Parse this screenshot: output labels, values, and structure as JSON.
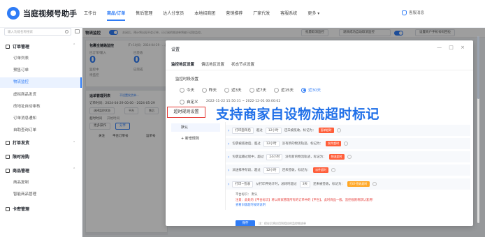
{
  "app": {
    "title": "当庭视频号助手"
  },
  "nav": {
    "items": [
      "工作台",
      "商品/订单",
      "售后管理",
      "达人分享员",
      "本地招商团",
      "营销推荐",
      "厂家代发",
      "客服系统",
      "更多 ▾"
    ],
    "active_index": 1,
    "right_label": "客服消息"
  },
  "sidebar": {
    "search_placeholder": "输入功能名称搜索",
    "groups": [
      {
        "label": "订单管理",
        "items": [
          "订单列表",
          "预售订单",
          "物流监控",
          "虚拟商品发货",
          "改地址自动审核",
          "订单消息通知",
          "自助查询订单"
        ]
      },
      {
        "label": "打单发货"
      },
      {
        "label": "限时抢购"
      },
      {
        "label": "商品管理",
        "items": [
          "商品复制",
          "智能商品管理"
        ]
      },
      {
        "label": "卡密管理"
      }
    ],
    "active_item": "物流监控"
  },
  "monitor": {
    "title": "物流监控",
    "desc": "关闭后，预计将出现不会订单，已订阅的物流单将被只读取监控。",
    "btn_batch": "批量取消监控",
    "btn_auto": "退款成功自动取消监控",
    "btn_phone": "设置商户手机号码回拉"
  },
  "left_card": {
    "title": "包裹全链路监控",
    "sub": "(T+1时间：2024-04-29 - ...)",
    "stat1_label": "已订单/输入",
    "stat1_value": "0",
    "stat1_small": "监控中",
    "stat2_label": "已签收",
    "stat2_value": "0",
    "stat2_small": "已完成",
    "waiting_label": "待监控"
  },
  "list_card": {
    "title": "运单管理列表",
    "link": "不设置发货单...",
    "order_time": "订单时间：2024-04-29 00:00 - 2024-05-29",
    "filter1": "选择监控状态",
    "filter2": "平台",
    "filter3": "售后",
    "timeout_label": "超时时间",
    "timeout_value": "开始时间",
    "btn_more": "更多操作",
    "btn_share": "分享",
    "col1": "关注",
    "col2": "平台订单号",
    "col3": "运单号"
  },
  "dialog": {
    "title": "设置",
    "tabs": [
      "监控地区设置",
      "偏远地区设置",
      "状态节点设置"
    ],
    "active_tab": 0,
    "section_label": "监控时段设置",
    "radios": [
      "今天",
      "昨天",
      "近3天",
      "近7天",
      "近15天",
      "近30天"
    ],
    "radio_selected": 5,
    "custom_label": "自定义",
    "date_from": "2022-11-22 15:50:31",
    "date_sep": "~",
    "date_to": "2022-12-01 00:00:02",
    "highlight_label": "超时规则设置",
    "caption": "支持商家自设物流超时标记",
    "rule_default": "默认",
    "rule_add": "+ 新增规则",
    "rules": [
      {
        "prefix": "打印面单后",
        "mid": "超过",
        "sel": "12小时",
        "text": "还未被揽收，标记为：",
        "tag": "面单超时"
      },
      {
        "prefix": "包裹被揽收后，超过",
        "mid": "",
        "sel": "12小时",
        "text": "没有新的物流轨迹，标记为：",
        "tag": "发件超时"
      },
      {
        "prefix": "包裹运输过程中，超过",
        "mid": "",
        "sel": "24小时",
        "text": "没有新的物流轨迹，标记为：",
        "tag": "物流超时"
      },
      {
        "prefix": "派送排件阶段，超过",
        "mid": "",
        "sel": "12小时",
        "text": "还未签收，标记为：",
        "tag": "派件超时"
      },
      {
        "prefix": "打印~签收",
        "mid": "从打印开始计时，总耗时超过",
        "sel": "3天",
        "text": "还未被签收，标记为：",
        "tag": "打印-签收超时"
      }
    ],
    "note1": "平台标识：   默认",
    "note2": "注意：此处的【平台标识】将以商家管理所有的订单中的【平台】，此时商品一般，监控规则将默认套用！",
    "note3": "查看旧版超时规则说明",
    "save_btn": "保存",
    "footer_note": "注：保存后将应用到相应的监控物流单",
    "window_controls": "— □ ×"
  }
}
